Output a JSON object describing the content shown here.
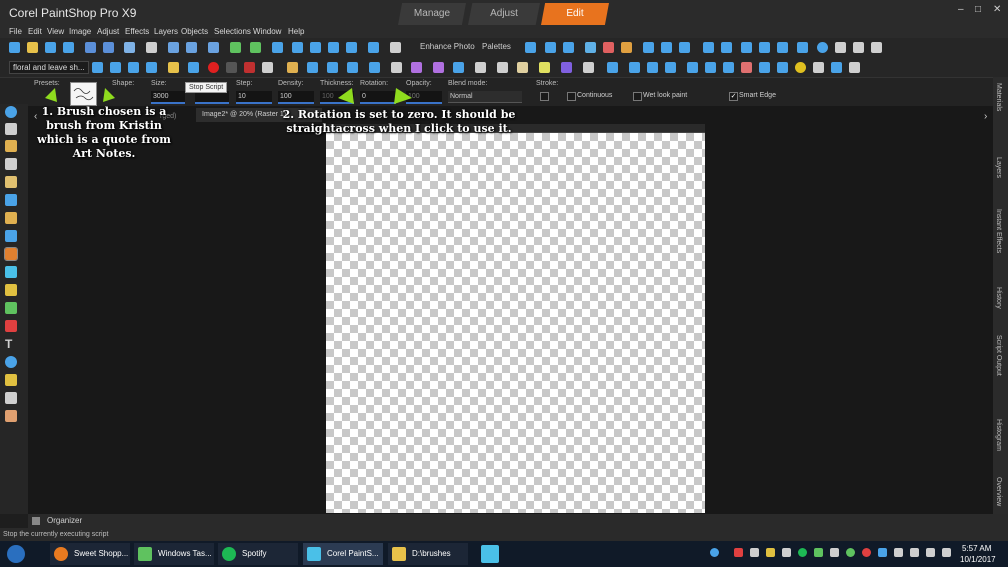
{
  "app": {
    "title": "Corel PaintShop Pro X9",
    "tabs": [
      "Manage",
      "Adjust",
      "Edit"
    ],
    "active_tab": "Edit",
    "window_controls": [
      "–",
      "□",
      "✕"
    ]
  },
  "menu": [
    "File",
    "Edit",
    "View",
    "Image",
    "Adjust",
    "Effects",
    "Layers",
    "Objects",
    "Selections",
    "Window",
    "Help"
  ],
  "toolbar": {
    "enhance_photo": "Enhance Photo",
    "palettes": "Palettes",
    "script_combo": "floral and leave sh..."
  },
  "tooltip": "Stop Script",
  "tool_options": {
    "presets_label": "Presets:",
    "shape_label": "Shape:",
    "size_label": "Size:",
    "size_value": "3000",
    "step_label": "Step:",
    "step_value": "10",
    "density_label": "Density:",
    "density_value": "100",
    "thickness_label": "Thickness:",
    "thickness_value": "100",
    "rotation_label": "Rotation:",
    "rotation_value": "0",
    "opacity_label": "Opacity:",
    "opacity_value": "100",
    "blend_label": "Blend mode:",
    "blend_value": "Normal",
    "stroke_label": "Stroke:",
    "continuous": "Continuous",
    "wet_look": "Wet look paint",
    "smart_edge": "Smart Edge"
  },
  "document": {
    "tab_title": "Image2* @  20% (Raster 1)",
    "merged_fragment": "rged)"
  },
  "annotations": {
    "note1": "1. Brush chosen is a brush from Kristin which is a quote from Art Notes.",
    "note2_line1": "2. Rotation is set to zero. It should be",
    "note2_line2": "straightacross when I click to use it."
  },
  "right_panels": [
    "Materials",
    "Layers",
    "Instant Effects",
    "History",
    "Script Output",
    "Histogram",
    "Overview"
  ],
  "organizer_label": "Organizer",
  "status_text": "Stop the currently executing script",
  "taskbar": {
    "apps": [
      "Sweet Shopp...",
      "Windows Tas...",
      "Spotify",
      "Corel PaintS...",
      "D:\\brushes"
    ],
    "time": "5:57 AM",
    "date": "10/1/2017"
  },
  "colors": {
    "accent": "#e8731e",
    "annotation_arrow": "#8fdc1e"
  }
}
